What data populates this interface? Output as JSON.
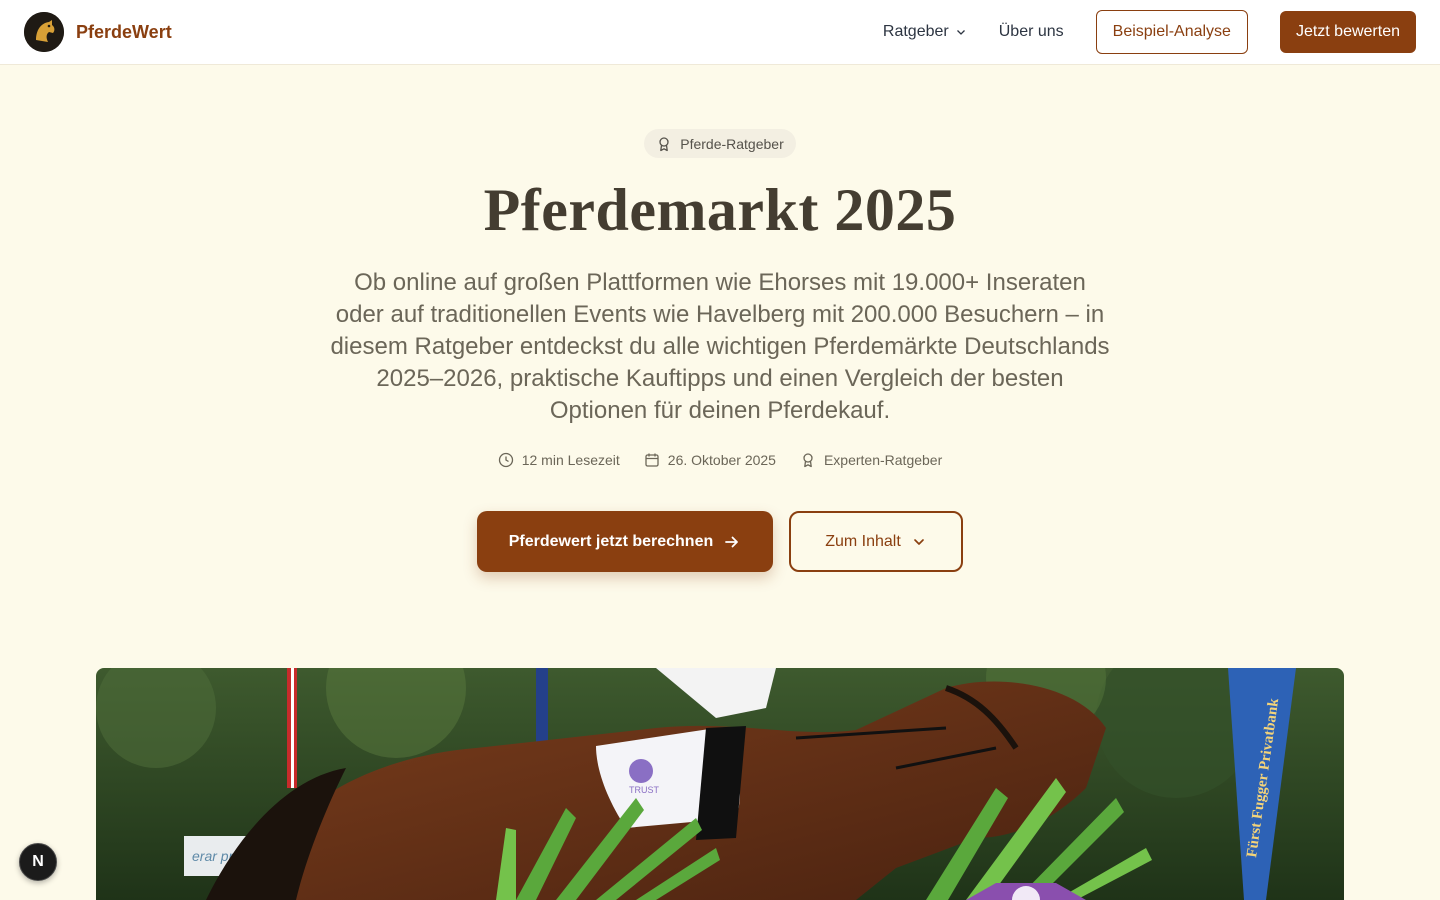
{
  "header": {
    "brand": "PferdeWert",
    "nav": {
      "ratgeber": "Ratgeber",
      "about": "Über uns",
      "example": "Beispiel-Analyse",
      "cta": "Jetzt bewerten"
    }
  },
  "hero": {
    "badge": "Pferde-Ratgeber",
    "title": "Pferdemarkt 2025",
    "lead": "Ob online auf großen Plattformen wie Ehorses mit 19.000+ Inseraten oder auf traditionellen Events wie Havelberg mit 200.000 Besuchern – in diesem Ratgeber entdeckst du alle wichtigen Pferdemärkte Deutschlands 2025–2026, praktische Kauftipps und einen Vergleich der besten Optionen für deinen Pferdekauf.",
    "meta": {
      "reading_time": "12 min Lesezeit",
      "date": "26. Oktober 2025",
      "type": "Experten-Ratgeber"
    },
    "cta_primary": "Pferdewert jetzt berechnen",
    "cta_secondary": "Zum Inhalt"
  },
  "image": {
    "banner_text": "Fürst Fugger Privatbank",
    "saddle_pad_text": "TRUST",
    "sign_text": "erar proli"
  },
  "devtools": {
    "label": "N"
  },
  "colors": {
    "brand": "#8a3f10",
    "background": "#fdfaea",
    "title": "#443d31"
  }
}
